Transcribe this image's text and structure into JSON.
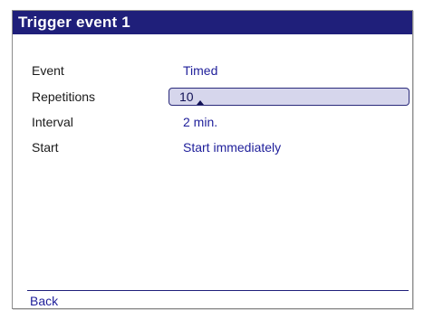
{
  "window": {
    "title": "Trigger event 1"
  },
  "settings": [
    {
      "label": "Event",
      "value": "Timed"
    },
    {
      "label": "Repetitions",
      "value": "10"
    },
    {
      "label": "Interval",
      "value": "2 min."
    },
    {
      "label": "Start",
      "value": "Start immediately"
    }
  ],
  "footer": {
    "back_label": "Back"
  },
  "colors": {
    "titlebar": "#1f1f7a",
    "value_text": "#1e1e9a",
    "field_bg": "#d6d6ec"
  }
}
